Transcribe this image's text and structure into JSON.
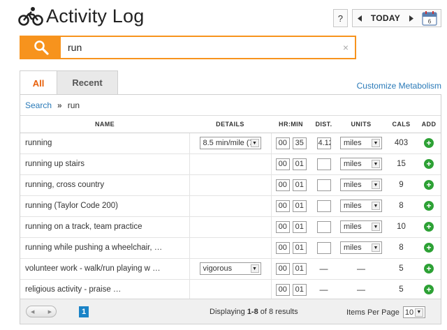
{
  "header": {
    "title": "Activity Log",
    "help_label": "?",
    "today_label": "TODAY",
    "calendar_day": "6"
  },
  "search": {
    "value": "run",
    "clear_label": "×"
  },
  "tabs": [
    {
      "label": "All",
      "active": true
    },
    {
      "label": "Recent",
      "active": false
    }
  ],
  "customize_link": "Customize Metabolism",
  "breadcrumb": {
    "link": "Search",
    "separator": "»",
    "current": "run"
  },
  "table": {
    "headers": {
      "name": "NAME",
      "details": "DETAILS",
      "hrmin": "HR:MIN",
      "dist": "DIST.",
      "units": "UNITS",
      "cals": "CALS",
      "add": "ADD"
    },
    "rows": [
      {
        "name": "running",
        "details": "8.5 min/mile (7",
        "hr": "00",
        "min": "35",
        "dist": "4.12",
        "units": "miles",
        "cals": "403"
      },
      {
        "name": "running up stairs",
        "details": "",
        "hr": "00",
        "min": "01",
        "dist": "",
        "units": "miles",
        "cals": "15"
      },
      {
        "name": "running, cross country",
        "details": "",
        "hr": "00",
        "min": "01",
        "dist": "",
        "units": "miles",
        "cals": "9"
      },
      {
        "name": "running (Taylor Code 200)",
        "details": "",
        "hr": "00",
        "min": "01",
        "dist": "",
        "units": "miles",
        "cals": "8"
      },
      {
        "name": "running on a track, team practice",
        "details": "",
        "hr": "00",
        "min": "01",
        "dist": "",
        "units": "miles",
        "cals": "10"
      },
      {
        "name": "running while pushing a wheelchair, …",
        "details": "",
        "hr": "00",
        "min": "01",
        "dist": "",
        "units": "miles",
        "cals": "8"
      },
      {
        "name": "volunteer work - walk/run playing w …",
        "details": "vigorous",
        "hr": "00",
        "min": "01",
        "dist": "—",
        "units": "—",
        "cals": "5"
      },
      {
        "name": "religious activity - praise …",
        "details": "",
        "hr": "00",
        "min": "01",
        "dist": "—",
        "units": "—",
        "cals": "5"
      }
    ]
  },
  "footer": {
    "page": "1",
    "display_prefix": "Displaying ",
    "display_range": "1-8",
    "display_suffix": " of 8 results",
    "items_per_page_label": "Items Per Page",
    "items_per_page_value": "10"
  },
  "colors": {
    "accent_orange": "#f7931d",
    "link_blue": "#2a7ab8",
    "add_green": "#2da135",
    "page_blue": "#1a83c7"
  }
}
